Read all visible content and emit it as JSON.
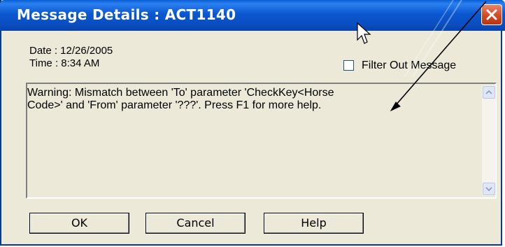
{
  "window": {
    "title": "Message Details : ACT1140"
  },
  "details": {
    "date": "Date : 12/26/2005",
    "time": "Time : 8:34 AM"
  },
  "filter": {
    "label": "Filter Out Message",
    "checked": false
  },
  "message": {
    "line1": "Warning: Mismatch between 'To' parameter 'CheckKey<Horse",
    "line2": "Code>' and 'From' parameter '???'. Press F1 for more help."
  },
  "buttons": {
    "ok": "OK",
    "cancel": "Cancel",
    "help": "Help"
  },
  "icons": {
    "close": "close-icon",
    "cursor": "mouse-cursor-icon",
    "arrow": "annotation-arrow-icon"
  },
  "colors": {
    "titlebar": "#0b57d0",
    "dialog_bg": "#ece9d8",
    "close_button": "#d24a22"
  }
}
